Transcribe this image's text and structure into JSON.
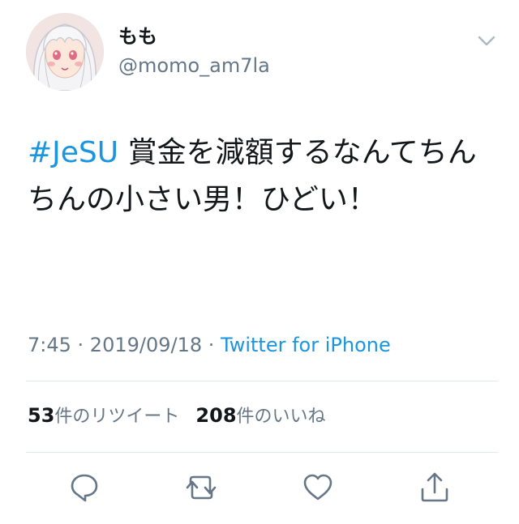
{
  "user": {
    "display_name": "もも",
    "handle": "@momo_am7la",
    "avatar_icon": "anime-avatar-icon"
  },
  "tweet": {
    "hashtag": "#JeSU",
    "text_after_hashtag": " 賞金を減額するなんてちんちんの小さい男！ひどい！"
  },
  "meta": {
    "time": "7:45",
    "separator": " · ",
    "date": "2019/09/18",
    "source": "Twitter for iPhone"
  },
  "stats": {
    "retweets_count": "53",
    "retweets_label": "件のリツイート",
    "likes_count": "208",
    "likes_label": "件のいいね"
  },
  "actions": {
    "reply_icon": "reply-icon",
    "retweet_icon": "retweet-icon",
    "like_icon": "heart-icon",
    "share_icon": "share-icon"
  },
  "colors": {
    "link": "#1b95e0",
    "secondary_text": "#657786",
    "divider": "#e1e8ed",
    "primary_text": "#14171a"
  }
}
